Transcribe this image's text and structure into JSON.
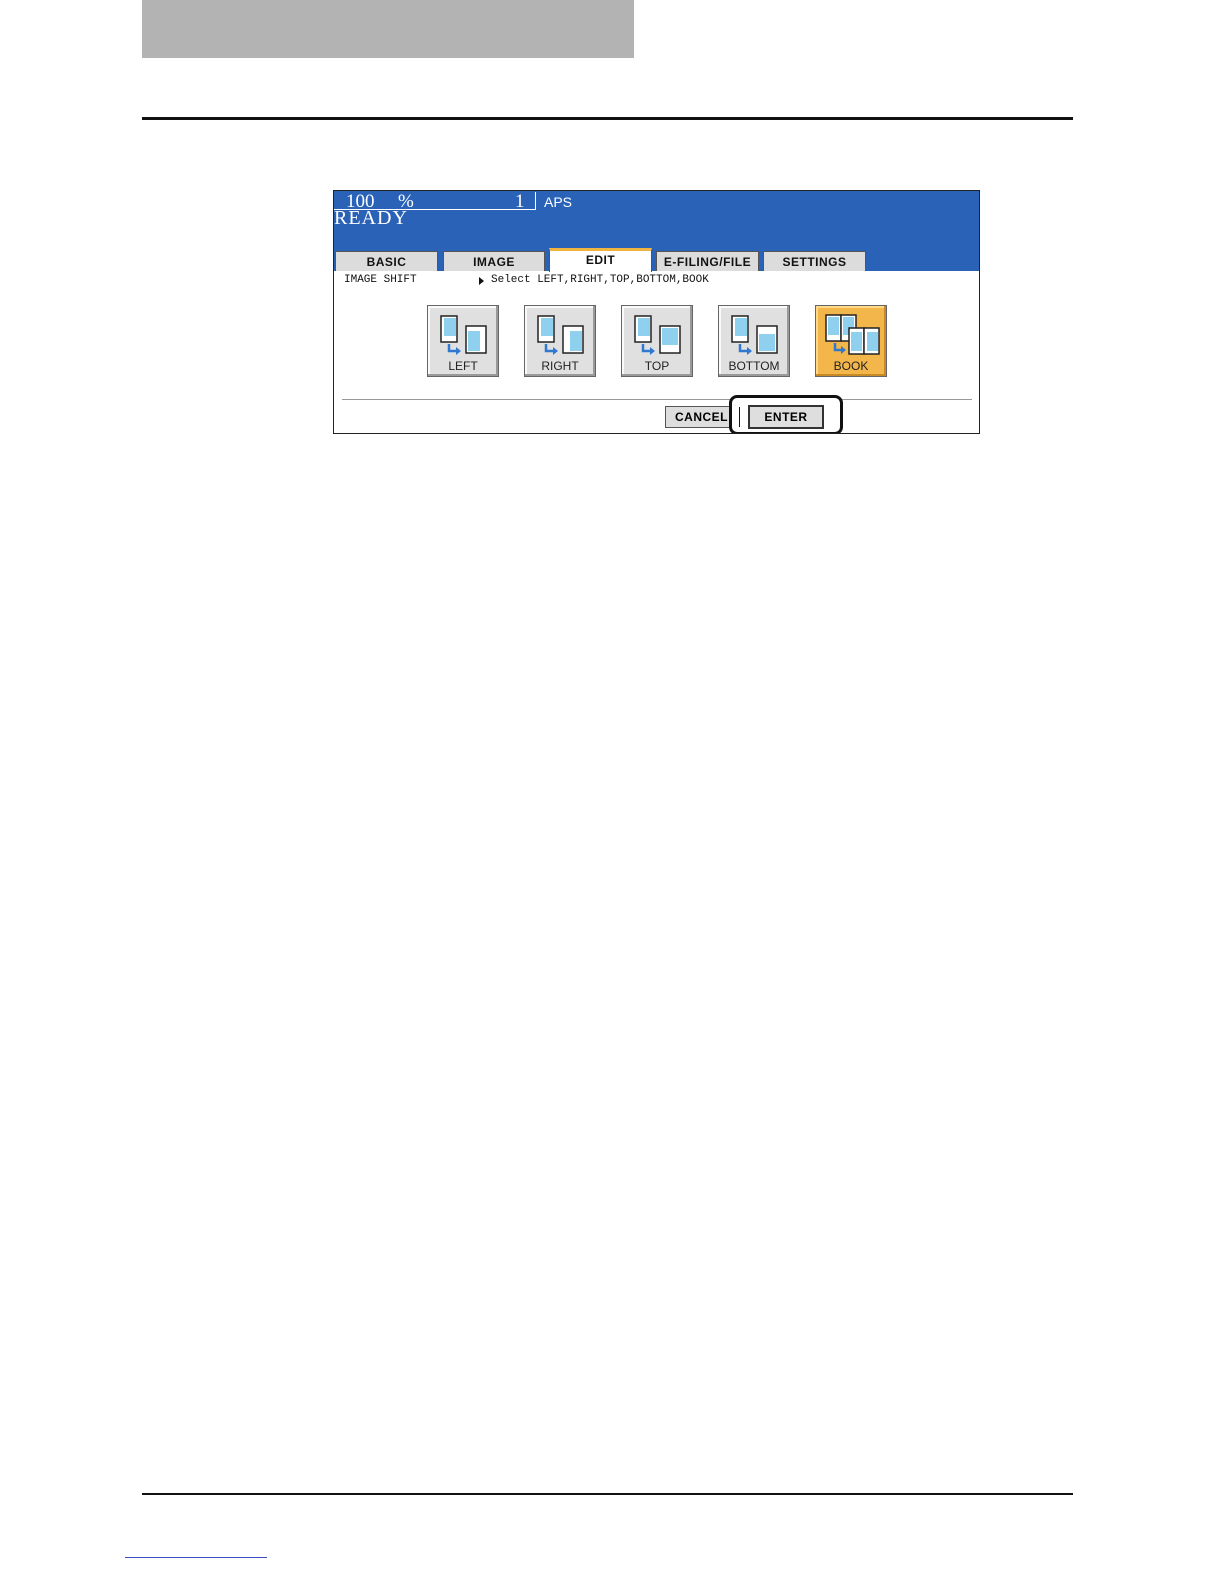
{
  "status": {
    "magnification": "100",
    "percent": "%",
    "copies": "1",
    "paper": "APS",
    "state": "READY"
  },
  "tabs": [
    "BASIC",
    "IMAGE",
    "EDIT",
    "E-FILING/FILE",
    "SETTINGS"
  ],
  "active_tab": "EDIT",
  "function": {
    "title": "IMAGE SHIFT",
    "message": "Select LEFT,RIGHT,TOP,BOTTOM,BOOK"
  },
  "options": {
    "left": "LEFT",
    "right": "RIGHT",
    "top": "TOP",
    "bottom": "BOTTOM",
    "book": "BOOK",
    "selected": "BOOK"
  },
  "actions": {
    "cancel": "CANCEL",
    "enter": "ENTER"
  },
  "colors": {
    "status_bar": "#2a62b8",
    "selected_option": "#f3b64a",
    "active_tab_accent": "#f0b440",
    "page_icon": "#8fd0ee",
    "arrow": "#2f79d1"
  }
}
